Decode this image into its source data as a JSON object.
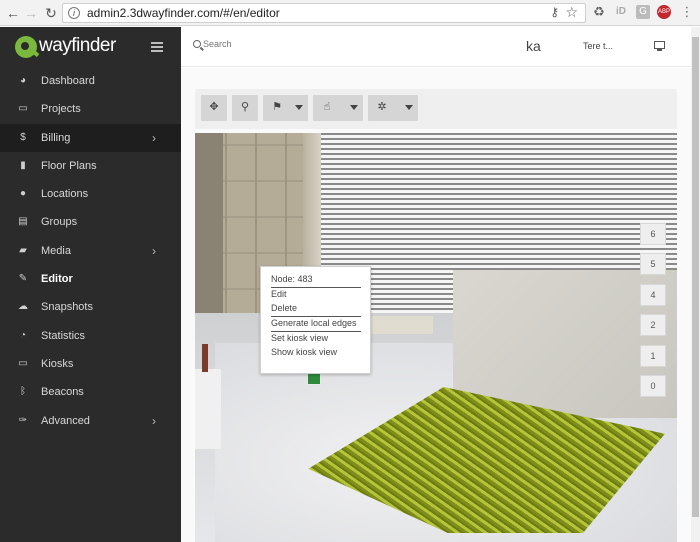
{
  "browser": {
    "url": "admin2.3dwayfinder.com/#/en/editor",
    "extensions": {
      "id_label": "iD",
      "g_label": "G",
      "abp_label": "ABP"
    }
  },
  "brand": {
    "name": "wayfinder",
    "logo_text": "3D",
    "accent": "#7ab83e"
  },
  "sidebar": {
    "items": [
      {
        "label": "Dashboard",
        "icon": "dashboard-icon",
        "glyph": "◕",
        "arrow": false,
        "active": false,
        "dark": false
      },
      {
        "label": "Projects",
        "icon": "briefcase-icon",
        "glyph": "▭",
        "arrow": false,
        "active": false,
        "dark": false
      },
      {
        "label": "Billing",
        "icon": "dollar-icon",
        "glyph": "$",
        "arrow": true,
        "active": false,
        "dark": true
      },
      {
        "label": "Floor Plans",
        "icon": "building-icon",
        "glyph": "▮",
        "arrow": false,
        "active": false,
        "dark": false
      },
      {
        "label": "Locations",
        "icon": "map-marker-icon",
        "glyph": "●",
        "arrow": false,
        "active": false,
        "dark": false
      },
      {
        "label": "Groups",
        "icon": "sitemap-icon",
        "glyph": "▤",
        "arrow": false,
        "active": false,
        "dark": false
      },
      {
        "label": "Media",
        "icon": "image-icon",
        "glyph": "▰",
        "arrow": true,
        "active": false,
        "dark": false
      },
      {
        "label": "Editor",
        "icon": "edit-icon",
        "glyph": "✎",
        "arrow": false,
        "active": true,
        "dark": false
      },
      {
        "label": "Snapshots",
        "icon": "cloud-icon",
        "glyph": "☁",
        "arrow": false,
        "active": false,
        "dark": false
      },
      {
        "label": "Statistics",
        "icon": "pie-chart-icon",
        "glyph": "◔",
        "arrow": false,
        "active": false,
        "dark": false
      },
      {
        "label": "Kiosks",
        "icon": "desktop-icon",
        "glyph": "▭",
        "arrow": false,
        "active": false,
        "dark": false
      },
      {
        "label": "Beacons",
        "icon": "bluetooth-icon",
        "glyph": "ᛒ",
        "arrow": false,
        "active": false,
        "dark": false
      },
      {
        "label": "Advanced",
        "icon": "wrench-icon",
        "glyph": "✑",
        "arrow": true,
        "active": false,
        "dark": false
      }
    ]
  },
  "header": {
    "search_placeholder": "Search",
    "user_initials": "ka",
    "user_name": "Tere t..."
  },
  "toolbar": {
    "buttons": [
      {
        "name": "move-tool",
        "glyph": "✥",
        "caret": false
      },
      {
        "name": "pin-tool",
        "glyph": "⚲",
        "caret": false
      },
      {
        "name": "flag-tool",
        "glyph": "⚑",
        "caret": true
      },
      {
        "name": "hand-tool",
        "glyph": "☝",
        "caret": true
      },
      {
        "name": "settings-tool",
        "glyph": "✲",
        "caret": true
      }
    ]
  },
  "levels": [
    "6",
    "5",
    "4",
    "2",
    "1",
    "0"
  ],
  "context_menu": {
    "title": "Node: 483",
    "items": [
      "Edit",
      "Delete",
      "Generate local edges",
      "Set kiosk view",
      "Show kiosk view"
    ]
  }
}
